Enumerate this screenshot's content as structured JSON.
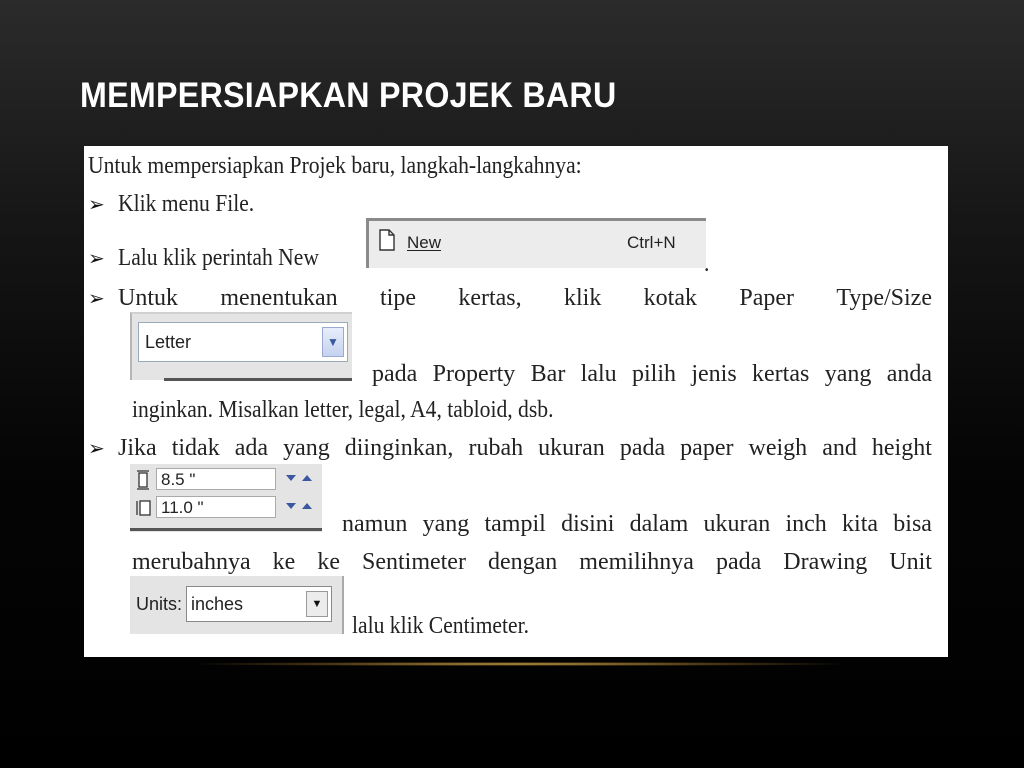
{
  "slide": {
    "title": "MEMPERSIAPKAN PROJEK BARU"
  },
  "content": {
    "intro": "Untuk mempersiapkan Projek baru, langkah-langkahnya:",
    "b1": "Klik menu File.",
    "b2_text": "Lalu klik perintah New",
    "b2_period": ".",
    "b3_line1": [
      "Untuk",
      "menentukan",
      "tipe",
      "kertas,",
      "klik",
      "kotak",
      "Paper",
      "Type/Size"
    ],
    "b3_line2": [
      "pada",
      "Property",
      "Bar",
      "lalu",
      "pilih",
      "jenis",
      "kertas",
      "yang",
      "anda"
    ],
    "b3_line3": "inginkan. Misalkan letter, legal, A4, tabloid, dsb.",
    "b4_line1": [
      "Jika",
      "tidak",
      "ada",
      "yang",
      "diinginkan,",
      "rubah",
      "ukuran",
      "pada",
      "paper",
      "weigh",
      "and",
      "height"
    ],
    "b4_line2": [
      "namun",
      "yang",
      "tampil",
      "disini",
      "dalam",
      "ukuran",
      "inch",
      "kita",
      "bisa"
    ],
    "b4_line3": [
      "merubahnya",
      "ke",
      "ke",
      "Sentimeter",
      "dengan",
      "memilihnya",
      "pada",
      "Drawing",
      "Unit"
    ],
    "b4_line4": "lalu klik Centimeter."
  },
  "menu_item": {
    "label": "New",
    "shortcut": "Ctrl+N",
    "icon": "new-document-icon"
  },
  "paper_combo": {
    "value": "Letter",
    "icon": "dropdown-arrow-icon"
  },
  "size_spinner": {
    "width": "8.5 \"",
    "height": "11.0 \""
  },
  "units": {
    "label": "Units:",
    "value": "inches"
  },
  "colors": {
    "title": "#ffffff",
    "accent_line": "#c9a24a"
  }
}
